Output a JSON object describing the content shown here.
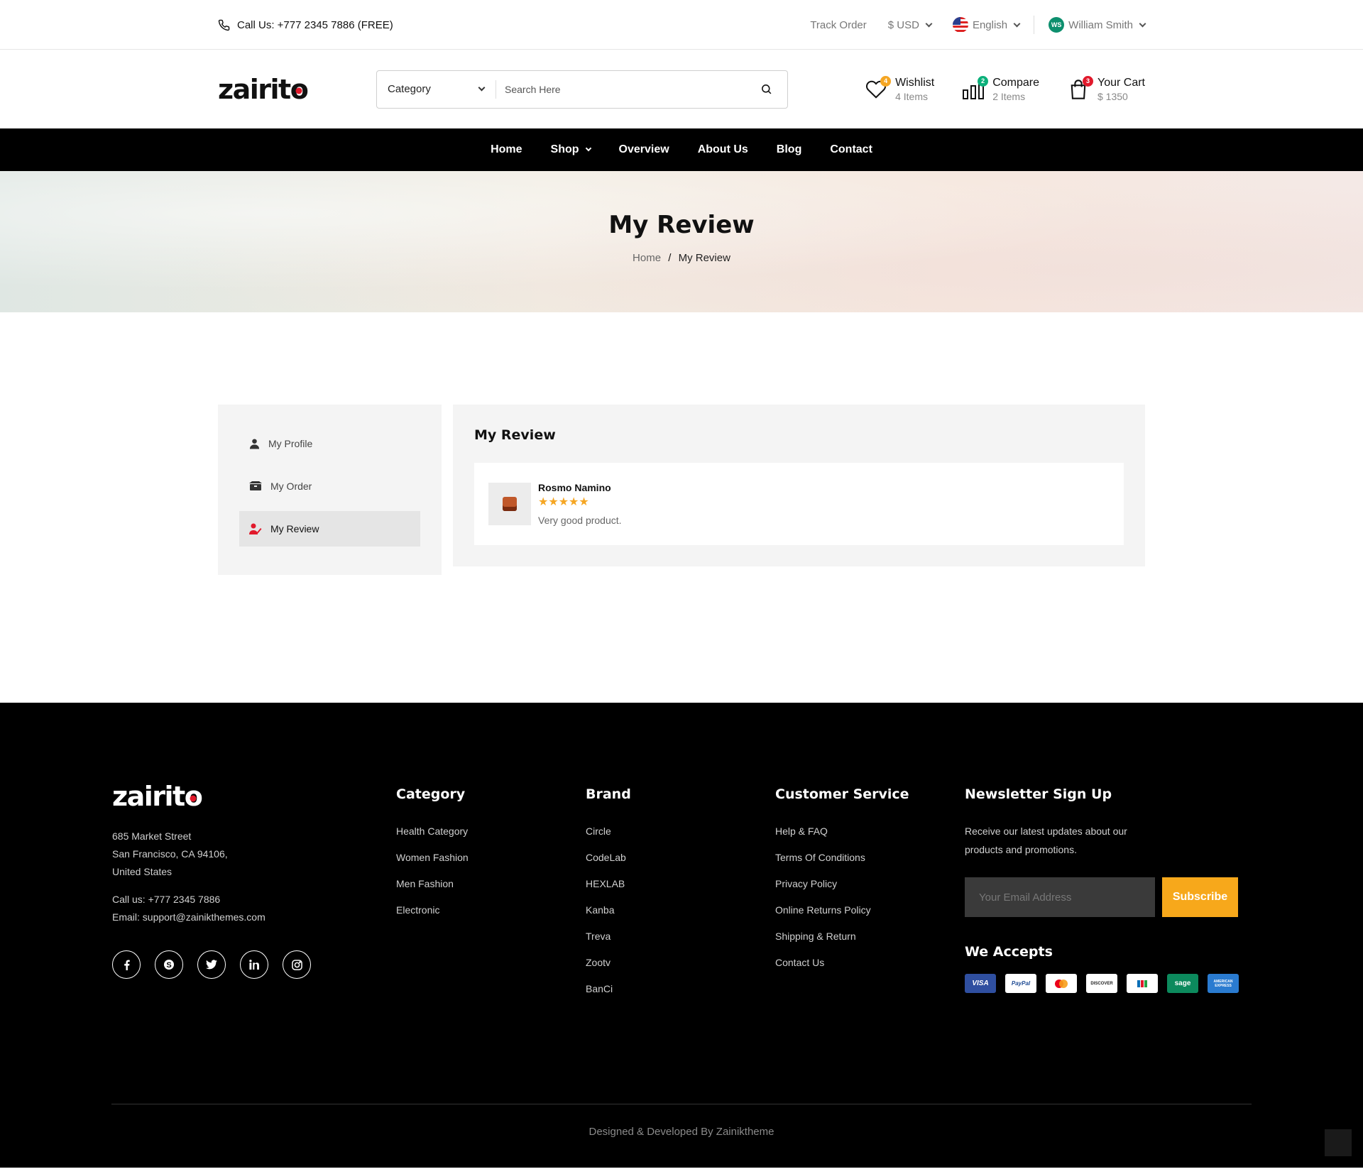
{
  "topbar": {
    "phone": "Call Us: +777 2345 7886 (FREE)",
    "track_order": "Track Order",
    "currency": "$ USD",
    "language": "English",
    "user_initials": "WS",
    "user_name": "William Smith"
  },
  "header": {
    "logo": "zairito",
    "search": {
      "category": "Category",
      "placeholder": "Search Here"
    },
    "wishlist": {
      "label": "Wishlist",
      "sub": "4 Items",
      "count": "4"
    },
    "compare": {
      "label": "Compare",
      "sub": "2 Items",
      "count": "2"
    },
    "cart": {
      "label": "Your Cart",
      "sub": "$ 1350",
      "count": "3"
    }
  },
  "nav": [
    "Home",
    "Shop",
    "Overview",
    "About Us",
    "Blog",
    "Contact"
  ],
  "hero": {
    "title": "My Review",
    "crumb_home": "Home",
    "crumb_sep": "/",
    "crumb_current": "My Review"
  },
  "sidebar": {
    "items": [
      {
        "label": "My Profile",
        "icon": "user-icon"
      },
      {
        "label": "My Order",
        "icon": "order-box-icon"
      },
      {
        "label": "My Review",
        "icon": "review-user-icon",
        "active": true
      }
    ]
  },
  "content": {
    "title": "My Review",
    "review": {
      "product_name": "Rosmo Namino",
      "rating": 5,
      "stars": "★★★★★",
      "text": "Very good product."
    }
  },
  "footer": {
    "logo": "zairito",
    "address": [
      "685 Market Street",
      "San Francisco, CA 94106,",
      "United States"
    ],
    "call": "Call us: +777 2345 7886",
    "email": "Email: support@zainikthemes.com",
    "socials": [
      "facebook-icon",
      "skype-icon",
      "twitter-icon",
      "linkedin-icon",
      "instagram-icon"
    ],
    "category": {
      "title": "Category",
      "links": [
        "Health Category",
        "Women Fashion",
        "Men Fashion",
        "Electronic"
      ]
    },
    "brand": {
      "title": "Brand",
      "links": [
        "Circle",
        "CodeLab",
        "HEXLAB",
        "Kanba",
        "Treva",
        "Zootv",
        "BanCi"
      ]
    },
    "service": {
      "title": "Customer Service",
      "links": [
        "Help & FAQ",
        "Terms Of Conditions",
        "Privacy Policy",
        "Online Returns Policy",
        "Shipping & Return",
        "Contact Us"
      ]
    },
    "newsletter": {
      "title": "Newsletter Sign Up",
      "text": "Receive our latest updates about our products and promotions.",
      "placeholder": "Your Email Address",
      "button": "Subscribe"
    },
    "accepts": {
      "title": "We Accepts",
      "cards": [
        "VISA",
        "PayPal",
        "mastercard",
        "DISCOVER",
        "jcb",
        "sage",
        "AMERICAN EXPRESS"
      ]
    },
    "copyright": "Designed & Developed By Zainiktheme"
  },
  "colors": {
    "accent": "#f7a81b",
    "brand_red": "#e1192b",
    "compare_badge": "#0bb07a",
    "wishlist_badge": "#f5a623"
  }
}
